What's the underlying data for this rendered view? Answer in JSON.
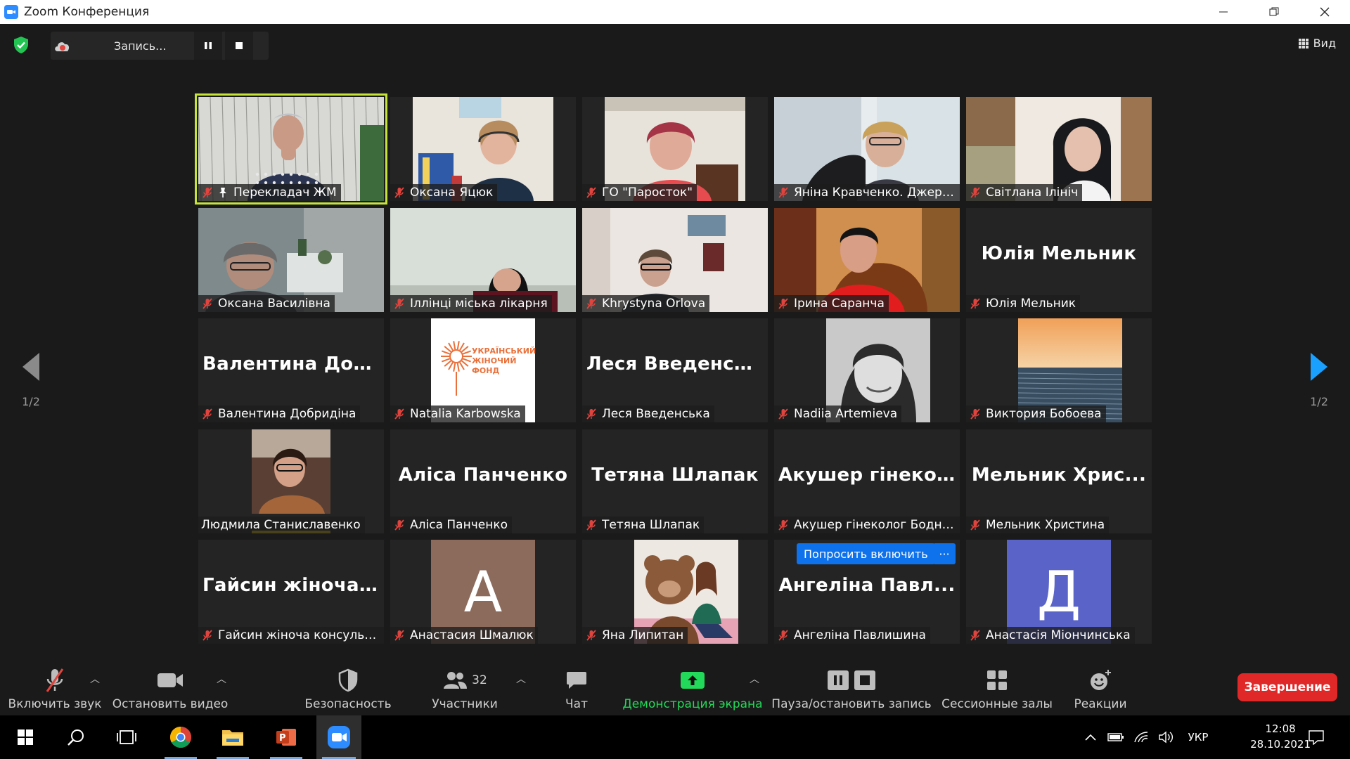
{
  "window": {
    "title": "Zoom Конференция"
  },
  "top": {
    "recording_label": "Запись...",
    "view_label": "Вид"
  },
  "nav": {
    "left_page": "1/2",
    "right_page": "1/2"
  },
  "tiles": [
    {
      "name": "Перекладач ЖМ",
      "type": "video",
      "active": true,
      "pinned": true
    },
    {
      "name": "Оксана Яцюк",
      "type": "video"
    },
    {
      "name": "ГО \"Паросток\"",
      "type": "video"
    },
    {
      "name": "Яніна Кравченко. Джере...",
      "type": "video"
    },
    {
      "name": "Світлана Ілініч",
      "type": "video"
    },
    {
      "name": "Оксана Василівна",
      "type": "video"
    },
    {
      "name": "Іллінці міська лікарня",
      "type": "video"
    },
    {
      "name": "Khrystyna Orlova",
      "type": "video"
    },
    {
      "name": "Ірина Саранча",
      "type": "video"
    },
    {
      "name": "Юлія Мельник",
      "type": "text",
      "big": "Юлія Мельник"
    },
    {
      "name": "Валентина Добридіна",
      "type": "text",
      "big": "Валентина  Доб..."
    },
    {
      "name": "Natalia Karbowska",
      "type": "logo",
      "logo_text": "УКРАЇНСЬКИЙ ЖІНОЧИЙ ФОНД"
    },
    {
      "name": "Леся Введенська",
      "type": "text",
      "big": "Леся Введенська"
    },
    {
      "name": "Nadiia Artemieva",
      "type": "photo"
    },
    {
      "name": "Виктория Бобоева",
      "type": "sea"
    },
    {
      "name": "Людмила Станиславенко",
      "type": "video",
      "speaking": true
    },
    {
      "name": "Аліса Панченко",
      "type": "text",
      "big": "Аліса Панченко"
    },
    {
      "name": "Тетяна Шлапак",
      "type": "text",
      "big": "Тетяна Шлапак"
    },
    {
      "name": "Акушер гінеколог Бодна...",
      "type": "text",
      "big": "Акушер  гінеко..."
    },
    {
      "name": "Мельник Христина",
      "type": "text",
      "big": "Мельник  Хрис..."
    },
    {
      "name": "Гайсин жіноча консульт...",
      "type": "text",
      "big": "Гайсин  жіноча..."
    },
    {
      "name": "Анастасия Шмалюк",
      "type": "letter",
      "letter": "А",
      "color": "#8c6a5c"
    },
    {
      "name": "Яна Липитан",
      "type": "photo2"
    },
    {
      "name": "Ангеліна Павлишина",
      "type": "text",
      "big": "Ангеліна  Павл...",
      "ask": "Попросить включить",
      "more": "···"
    },
    {
      "name": "Анастасія Міончинська",
      "type": "letter",
      "letter": "Д",
      "color": "#5a63c8"
    }
  ],
  "toolbar": {
    "unmute": "Включить звук",
    "stop_video": "Остановить видео",
    "security": "Безопасность",
    "participants": "Участники",
    "participants_count": "32",
    "chat": "Чат",
    "share": "Демонстрация экрана",
    "pause_rec": "Пауза/остановить запись",
    "breakout": "Сессионные залы",
    "reactions": "Реакции",
    "end": "Завершение"
  },
  "taskbar": {
    "lang": "УКР",
    "time": "12:08",
    "date": "28.10.2021"
  },
  "colors": {
    "accent": "#2d8cff",
    "active_speaker": "#c6e33b",
    "end": "#e02828",
    "share": "#23d959",
    "muted": "#e0443e"
  }
}
